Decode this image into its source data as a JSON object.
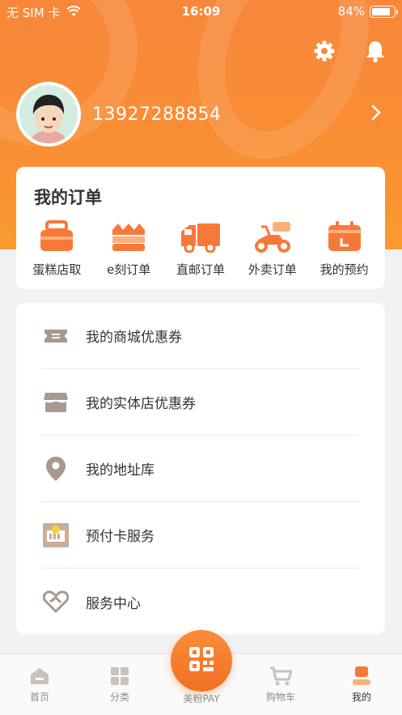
{
  "status_bar": {
    "carrier": "无 SIM 卡",
    "time": "16:09",
    "battery": "84%",
    "battery_level": 0.84
  },
  "header": {
    "settings_icon": "gear-icon",
    "notification_icon": "bell-icon"
  },
  "profile": {
    "phone": "13927288854"
  },
  "orders": {
    "title": "我的订单",
    "items": [
      {
        "label": "蛋糕店取",
        "icon": "cake-box-icon"
      },
      {
        "label": "e刻订单",
        "icon": "cake-icon"
      },
      {
        "label": "直邮订单",
        "icon": "truck-icon"
      },
      {
        "label": "外卖订单",
        "icon": "scooter-icon"
      },
      {
        "label": "我的预约",
        "icon": "calendar-icon"
      }
    ]
  },
  "menu": {
    "items": [
      {
        "label": "我的商城优惠券",
        "icon": "ticket-icon"
      },
      {
        "label": "我的实体店优惠券",
        "icon": "store-icon"
      },
      {
        "label": "我的地址库",
        "icon": "location-pin-icon"
      },
      {
        "label": "预付卡服务",
        "icon": "prepaid-card-icon"
      },
      {
        "label": "服务中心",
        "icon": "heart-handshake-icon"
      }
    ]
  },
  "tabbar": {
    "tabs": [
      {
        "label": "首页",
        "icon": "home-icon"
      },
      {
        "label": "分类",
        "icon": "grid-icon"
      },
      {
        "label": "美粉PAY",
        "icon": "qr-code-icon"
      },
      {
        "label": "购物车",
        "icon": "cart-icon"
      },
      {
        "label": "我的",
        "icon": "profile-icon"
      }
    ],
    "active": "我的"
  },
  "colors": {
    "brand_orange": "#f98d34",
    "accent_orange": "#f26f22",
    "icon_gray": "#9c8e86"
  }
}
